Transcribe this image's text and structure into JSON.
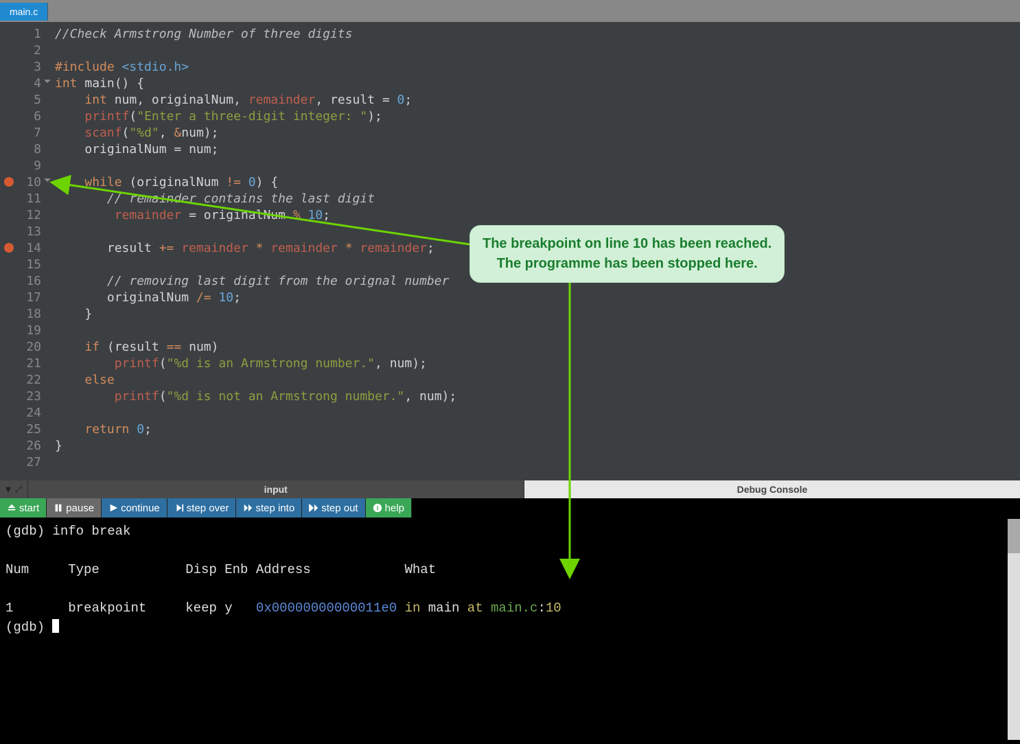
{
  "tab": {
    "filename": "main.c"
  },
  "code": {
    "lines": [
      {
        "n": 1,
        "bp": false,
        "fold": false,
        "segs": [
          [
            "c-comment",
            "//Check Armstrong Number of three digits"
          ]
        ]
      },
      {
        "n": 2,
        "bp": false,
        "fold": false,
        "segs": []
      },
      {
        "n": 3,
        "bp": false,
        "fold": false,
        "segs": [
          [
            "c-pp",
            "#include "
          ],
          [
            "c-inc",
            "<stdio.h>"
          ]
        ]
      },
      {
        "n": 4,
        "bp": false,
        "fold": true,
        "segs": [
          [
            "c-kw",
            "int"
          ],
          [
            "",
            " "
          ],
          [
            "c-fn",
            "main"
          ],
          [
            "",
            "() {"
          ]
        ]
      },
      {
        "n": 5,
        "bp": false,
        "fold": false,
        "segs": [
          [
            "",
            "    "
          ],
          [
            "c-kw",
            "int"
          ],
          [
            "",
            " num, originalNum, "
          ],
          [
            "c-red",
            "remainder"
          ],
          [
            "",
            ", result = "
          ],
          [
            "c-num",
            "0"
          ],
          [
            "",
            ";"
          ]
        ]
      },
      {
        "n": 6,
        "bp": false,
        "fold": false,
        "segs": [
          [
            "",
            "    "
          ],
          [
            "c-red",
            "printf"
          ],
          [
            "",
            "("
          ],
          [
            "c-str",
            "\"Enter a three-digit integer: \""
          ],
          [
            "",
            ");"
          ]
        ]
      },
      {
        "n": 7,
        "bp": false,
        "fold": false,
        "segs": [
          [
            "",
            "    "
          ],
          [
            "c-red",
            "scanf"
          ],
          [
            "",
            "("
          ],
          [
            "c-str",
            "\"%d\""
          ],
          [
            "",
            ", "
          ],
          [
            "c-op",
            "&"
          ],
          [
            "",
            "num);"
          ]
        ]
      },
      {
        "n": 8,
        "bp": false,
        "fold": false,
        "segs": [
          [
            "",
            "    originalNum = num;"
          ]
        ]
      },
      {
        "n": 9,
        "bp": false,
        "fold": false,
        "segs": []
      },
      {
        "n": 10,
        "bp": true,
        "fold": true,
        "segs": [
          [
            "",
            "    "
          ],
          [
            "c-kw",
            "while"
          ],
          [
            "",
            " (originalNum "
          ],
          [
            "c-op",
            "!="
          ],
          [
            "",
            " "
          ],
          [
            "c-num",
            "0"
          ],
          [
            "",
            ") {"
          ]
        ]
      },
      {
        "n": 11,
        "bp": false,
        "fold": false,
        "segs": [
          [
            "",
            "       "
          ],
          [
            "c-comment",
            "// remainder contains the last digit"
          ]
        ]
      },
      {
        "n": 12,
        "bp": false,
        "fold": false,
        "segs": [
          [
            "",
            "        "
          ],
          [
            "c-red",
            "remainder"
          ],
          [
            "",
            " = originalNum "
          ],
          [
            "c-op",
            "%"
          ],
          [
            "",
            " "
          ],
          [
            "c-num",
            "10"
          ],
          [
            "",
            ";"
          ]
        ]
      },
      {
        "n": 13,
        "bp": false,
        "fold": false,
        "segs": []
      },
      {
        "n": 14,
        "bp": true,
        "fold": false,
        "segs": [
          [
            "",
            "       result "
          ],
          [
            "c-op",
            "+="
          ],
          [
            "",
            " "
          ],
          [
            "c-red",
            "remainder"
          ],
          [
            "",
            " "
          ],
          [
            "c-op",
            "*"
          ],
          [
            "",
            " "
          ],
          [
            "c-red",
            "remainder"
          ],
          [
            "",
            " "
          ],
          [
            "c-op",
            "*"
          ],
          [
            "",
            " "
          ],
          [
            "c-red",
            "remainder"
          ],
          [
            "",
            ";"
          ]
        ]
      },
      {
        "n": 15,
        "bp": false,
        "fold": false,
        "segs": []
      },
      {
        "n": 16,
        "bp": false,
        "fold": false,
        "segs": [
          [
            "",
            "       "
          ],
          [
            "c-comment",
            "// removing last digit from the orignal number"
          ]
        ]
      },
      {
        "n": 17,
        "bp": false,
        "fold": false,
        "segs": [
          [
            "",
            "       originalNum "
          ],
          [
            "c-op",
            "/="
          ],
          [
            "",
            " "
          ],
          [
            "c-num",
            "10"
          ],
          [
            "",
            ";"
          ]
        ]
      },
      {
        "n": 18,
        "bp": false,
        "fold": false,
        "segs": [
          [
            "",
            "    }"
          ]
        ]
      },
      {
        "n": 19,
        "bp": false,
        "fold": false,
        "segs": []
      },
      {
        "n": 20,
        "bp": false,
        "fold": false,
        "segs": [
          [
            "",
            "    "
          ],
          [
            "c-kw",
            "if"
          ],
          [
            "",
            " (result "
          ],
          [
            "c-op",
            "=="
          ],
          [
            "",
            " num)"
          ]
        ]
      },
      {
        "n": 21,
        "bp": false,
        "fold": false,
        "segs": [
          [
            "",
            "        "
          ],
          [
            "c-red",
            "printf"
          ],
          [
            "",
            "("
          ],
          [
            "c-str",
            "\"%d is an Armstrong number.\""
          ],
          [
            "",
            ", num);"
          ]
        ]
      },
      {
        "n": 22,
        "bp": false,
        "fold": false,
        "segs": [
          [
            "",
            "    "
          ],
          [
            "c-kw",
            "else"
          ]
        ]
      },
      {
        "n": 23,
        "bp": false,
        "fold": false,
        "segs": [
          [
            "",
            "        "
          ],
          [
            "c-red",
            "printf"
          ],
          [
            "",
            "("
          ],
          [
            "c-str",
            "\"%d is not an Armstrong number.\""
          ],
          [
            "",
            ", num);"
          ]
        ]
      },
      {
        "n": 24,
        "bp": false,
        "fold": false,
        "segs": []
      },
      {
        "n": 25,
        "bp": false,
        "fold": false,
        "segs": [
          [
            "",
            "    "
          ],
          [
            "c-kw",
            "return"
          ],
          [
            "",
            " "
          ],
          [
            "c-num",
            "0"
          ],
          [
            "",
            ";"
          ]
        ]
      },
      {
        "n": 26,
        "bp": false,
        "fold": false,
        "segs": [
          [
            "",
            "}"
          ]
        ]
      },
      {
        "n": 27,
        "bp": false,
        "fold": false,
        "segs": []
      }
    ]
  },
  "annotation": {
    "line1": "The breakpoint on line 10 has been reached.",
    "line2": "The programme has been stopped here."
  },
  "panel": {
    "tab_input": "input",
    "tab_debug": "Debug Console"
  },
  "debug_buttons": {
    "start": "start",
    "pause": "pause",
    "continue": "continue",
    "step_over": "step over",
    "step_into": "step into",
    "step_out": "step out",
    "help": "help"
  },
  "console": {
    "prompt": "(gdb)",
    "cmd": "info break",
    "header": "Num     Type           Disp Enb Address            What",
    "row_num": "1",
    "row_type": "breakpoint",
    "row_disp": "keep",
    "row_enb": "y",
    "row_addr": "0x00000000000011e0",
    "row_in": "in",
    "row_fn": "main",
    "row_at": "at",
    "row_file": "main.c",
    "row_line": "10"
  }
}
